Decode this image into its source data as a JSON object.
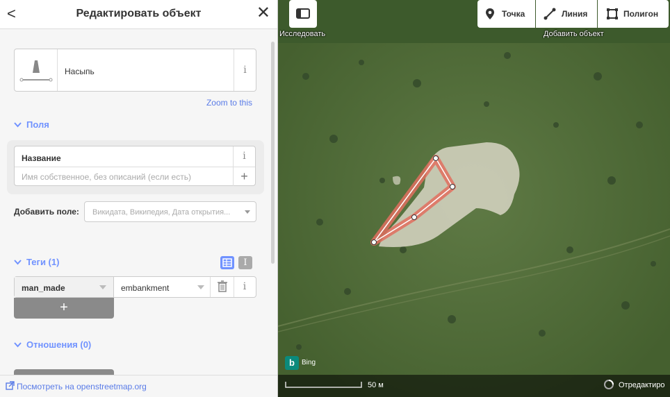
{
  "header": {
    "title": "Редактировать объект",
    "back": "<",
    "close": "✕"
  },
  "preset": {
    "name": "Насыпь",
    "info": "i"
  },
  "zoom_link": "Zoom to this",
  "fields_section": {
    "label": "Поля"
  },
  "name_field": {
    "label": "Название",
    "placeholder": "Имя собственное, без описаний (если есть)",
    "info": "i",
    "plus": "+"
  },
  "add_field": {
    "label": "Добавить поле:",
    "placeholder": "Викидата, Википедия, Дата открытия..."
  },
  "tags_section": {
    "label": "Теги (1)",
    "text_view": "I"
  },
  "tag": {
    "key": "man_made",
    "value": "embankment",
    "info": "i"
  },
  "add_tag": "+",
  "relations_section": {
    "label": "Отношения (0)"
  },
  "footer": {
    "link": "Посмотреть на openstreetmap.org"
  },
  "map": {
    "explore_label": "Исследовать",
    "add_object_label": "Добавить объект",
    "point": "Точка",
    "line": "Линия",
    "polygon": "Полигон",
    "attribution": "Bing",
    "scale": "50 м",
    "edited_label": "Отредактиро"
  },
  "colors": {
    "accent": "#7092ff",
    "selection": "#e06e5f",
    "imagery": "#4f6a3a"
  }
}
